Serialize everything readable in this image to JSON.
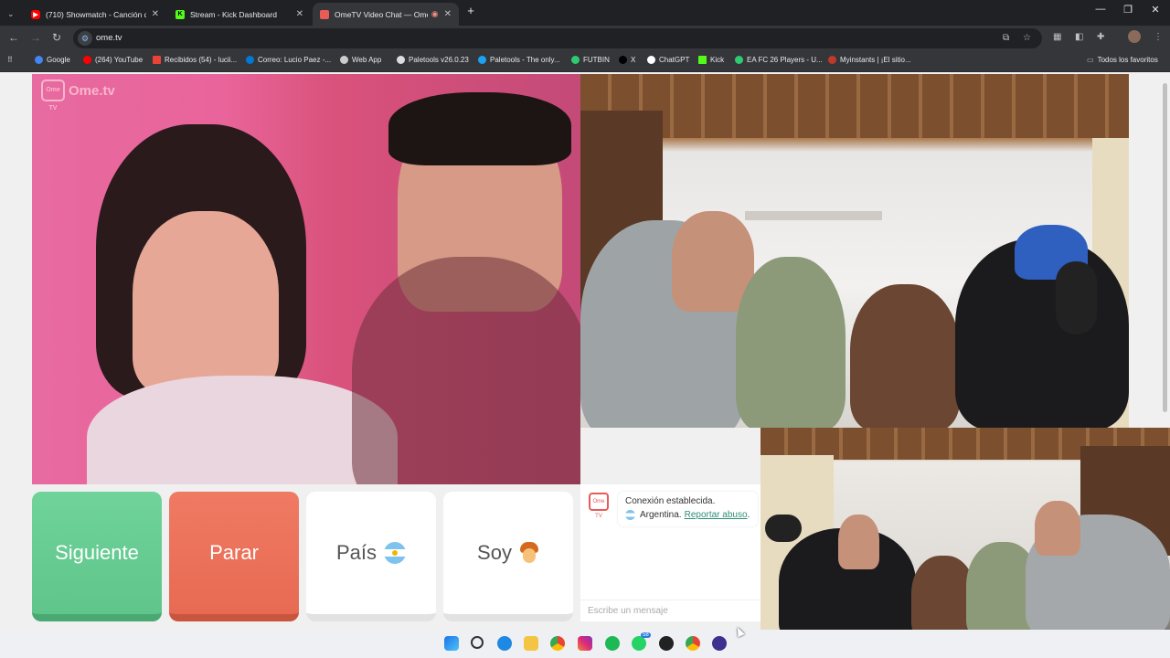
{
  "tabs": [
    {
      "label": "(710) Showmatch - Canción del",
      "favicon_color": "#ff0000"
    },
    {
      "label": "Stream - Kick Dashboard",
      "favicon_color": "#53fc18"
    },
    {
      "label": "OmeTV Video Chat — Ome",
      "favicon_color": "#e85b57"
    }
  ],
  "address": {
    "url": "ome.tv"
  },
  "bookmarks": [
    {
      "label": "Google",
      "color": "#4285f4"
    },
    {
      "label": "(264) YouTube",
      "color": "#ff0000"
    },
    {
      "label": "Recibidos (54) - lucii...",
      "color": "#ea4335"
    },
    {
      "label": "Correo: Lucio Paez -...",
      "color": "#0078d4"
    },
    {
      "label": "Web App",
      "color": "#cccccc"
    },
    {
      "label": "Paletools v26.0.23",
      "color": "#ffffff"
    },
    {
      "label": "Paletools - The only...",
      "color": "#1da1f2"
    },
    {
      "label": "FUTBIN",
      "color": "#2ecc71"
    },
    {
      "label": "X",
      "color": "#000000"
    },
    {
      "label": "ChatGPT",
      "color": "#ffffff"
    },
    {
      "label": "Kick",
      "color": "#53fc18"
    },
    {
      "label": "EA FC 26 Players - U...",
      "color": "#2ecc71"
    },
    {
      "label": "Myinstants | ¡El sitio...",
      "color": "#c0392b"
    }
  ],
  "all_bookmarks_label": "Todos los favoritos",
  "logo_text": "Ome.tv",
  "logo_box_text": "Ome TV",
  "buttons": {
    "next": "Siguiente",
    "stop": "Parar",
    "country": "País",
    "me": "Soy"
  },
  "chat": {
    "icon_text": "Ome TV",
    "status": "Conexión establecida.",
    "country": "Argentina.",
    "report": "Reportar abuso",
    "report_suffix": ".",
    "input_placeholder": "Escribe un mensaje"
  },
  "taskbar": {
    "badge": "58"
  },
  "colors": {
    "next": "#5fc58b",
    "stop": "#e86a52",
    "accent": "#2f8f74"
  }
}
